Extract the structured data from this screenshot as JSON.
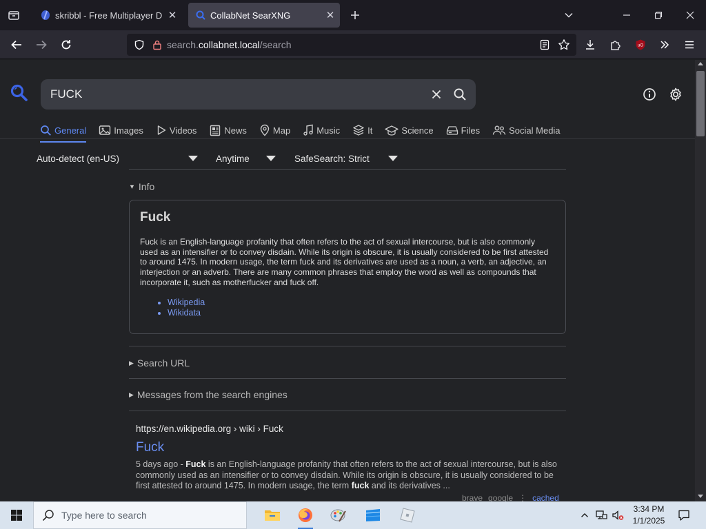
{
  "browser": {
    "tabs": [
      {
        "title": "skribbl - Free Multiplayer Drawi",
        "active": false
      },
      {
        "title": "CollabNet SearXNG",
        "active": true
      }
    ],
    "url": {
      "scheme_host_prefix": "search.",
      "domain": "collabnet.local",
      "path": "/search"
    }
  },
  "search": {
    "query": "FUCK",
    "categories": [
      {
        "label": "General",
        "icon": "search-icon",
        "active": true
      },
      {
        "label": "Images",
        "icon": "image-icon"
      },
      {
        "label": "Videos",
        "icon": "play-icon"
      },
      {
        "label": "News",
        "icon": "newspaper-icon"
      },
      {
        "label": "Map",
        "icon": "map-pin-icon"
      },
      {
        "label": "Music",
        "icon": "music-note-icon"
      },
      {
        "label": "It",
        "icon": "layers-icon"
      },
      {
        "label": "Science",
        "icon": "graduation-cap-icon"
      },
      {
        "label": "Files",
        "icon": "drive-icon"
      },
      {
        "label": "Social Media",
        "icon": "people-icon"
      }
    ],
    "filters": {
      "language": "Auto-detect (en-US)",
      "time": "Anytime",
      "safesearch": "SafeSearch: Strict"
    }
  },
  "info": {
    "toggle_label": "Info",
    "title": "Fuck",
    "description": "Fuck is an English-language profanity that often refers to the act of sexual intercourse, but is also commonly used as an intensifier or to convey disdain. While its origin is obscure, it is usually considered to be first attested to around 1475. In modern usage, the term fuck and its derivatives are used as a noun, a verb, an adjective, an interjection or an adverb. There are many common phrases that employ the word as well as compounds that incorporate it, such as motherfucker and fuck off.",
    "links": [
      "Wikipedia",
      "Wikidata"
    ]
  },
  "sections": {
    "search_url": "Search URL",
    "messages": "Messages from the search engines"
  },
  "result": {
    "url": "https://en.wikipedia.org",
    "breadcrumb": " › wiki › Fuck",
    "title": "Fuck",
    "date": "5 days ago - ",
    "term": "Fuck",
    "snippet_a": " is an English-language profanity that often refers to the act of sexual intercourse, but is also commonly used as an intensifier or to convey disdain. While its origin is obscure, it is usually considered to be first attested to around 1475. In modern usage, the term ",
    "term2": "fuck",
    "snippet_b": " and its derivatives ...",
    "engines": [
      "brave",
      "google"
    ],
    "cached_label": "cached"
  },
  "taskbar": {
    "search_placeholder": "Type here to search",
    "time": "3:34 PM",
    "date": "1/1/2025"
  },
  "colors": {
    "accent": "#5e87f0",
    "link": "#6a8ef2",
    "background": "#222326"
  }
}
